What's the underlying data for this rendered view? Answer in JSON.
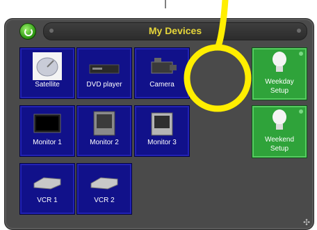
{
  "window": {
    "title": "My Devices"
  },
  "devices": [
    {
      "label": "Satellite",
      "icon": "satellite-dish-icon"
    },
    {
      "label": "DVD player",
      "icon": "dvd-player-icon"
    },
    {
      "label": "Camera",
      "icon": "camera-icon"
    },
    {
      "label": "Monitor 1",
      "icon": "monitor-icon"
    },
    {
      "label": "Monitor 2",
      "icon": "monitor-icon"
    },
    {
      "label": "Monitor 3",
      "icon": "monitor-icon"
    },
    {
      "label": "VCR 1",
      "icon": "vcr-icon"
    },
    {
      "label": "VCR 2",
      "icon": "vcr-icon"
    }
  ],
  "scenes": [
    {
      "label_line1": "Weekday",
      "label_line2": "Setup",
      "icon": "light-bulb-icon"
    },
    {
      "label_line1": "Weekend",
      "label_line2": "Setup",
      "icon": "light-bulb-icon"
    }
  ],
  "colors": {
    "panel": "#4a4a4a",
    "device_tile": "#11118a",
    "scene_tile": "#2fa33a",
    "title_text": "#e6d63a",
    "annotation": "#ffee00"
  }
}
